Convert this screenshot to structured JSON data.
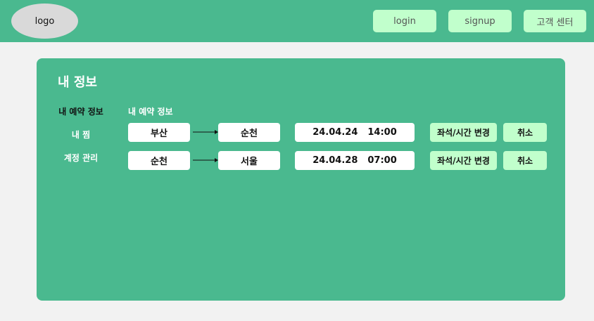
{
  "header": {
    "logo": "logo",
    "login": "login",
    "signup": "signup",
    "customer_center": "고객 센터"
  },
  "panel": {
    "title": "내 정보",
    "sidebar": [
      {
        "label": "내 예약 정보",
        "active": true
      },
      {
        "label": "내 찜",
        "active": false
      },
      {
        "label": "계정 관리",
        "active": false
      }
    ],
    "section_label": "내 예약 정보",
    "reservations": [
      {
        "from": "부산",
        "to": "순천",
        "date": "24.04.24",
        "time": "14:00",
        "change": "좌석/시간 변경",
        "cancel": "취소"
      },
      {
        "from": "순천",
        "to": "서울",
        "date": "24.04.28",
        "time": "07:00",
        "change": "좌석/시간 변경",
        "cancel": "취소"
      }
    ]
  },
  "colors": {
    "brand_green": "#4ab98f",
    "button_mint": "#c1ffcc",
    "page_bg": "#f2f2f2"
  }
}
